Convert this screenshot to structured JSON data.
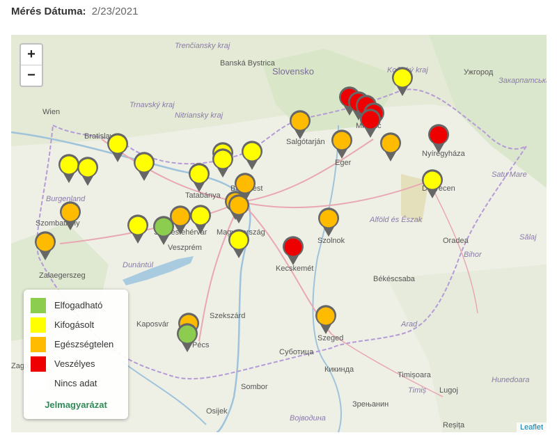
{
  "header": {
    "label": "Mérés Dátuma:",
    "date": "2/23/2021"
  },
  "zoom": {
    "in": "+",
    "out": "−"
  },
  "legend": {
    "items": [
      {
        "label": "Elfogadható",
        "color": "#8ccd50"
      },
      {
        "label": "Kifogásolt",
        "color": "#ffff00"
      },
      {
        "label": "Egészségtelen",
        "color": "#ffbb00"
      },
      {
        "label": "Veszélyes",
        "color": "#ee0000"
      },
      {
        "label": "Nincs adat",
        "color": "#ffffff"
      }
    ],
    "title": "Jelmagyarázat"
  },
  "attribution": "Leaflet",
  "map_labels": [
    "Trenčiansky kraj",
    "Banská Bystrica",
    "Slovensko",
    "Košický kraj",
    "Ужгород",
    "Закарпатська область",
    "Trnavský kraj",
    "Nitriansky kraj",
    "Wien",
    "Bratislava",
    "Miskolc",
    "Nyíregyháza",
    "Salgótarján",
    "Eger",
    "Tatabánya",
    "Budapest",
    "Debrecen",
    "Satu Mare",
    "Burgenland",
    "Szombathely",
    "Alföld és Észak",
    "Szolnok",
    "Magyarország",
    "Székesfehérvár",
    "Veszprém",
    "Oradea",
    "Bihor",
    "Sălaj",
    "Dunántúl",
    "Zalaegerszeg",
    "Kecskemét",
    "Békéscsaba",
    "Szekszárd",
    "Kaposvár",
    "Arad",
    "Szeged",
    "Pécs",
    "Суботица",
    "Timișoara",
    "Timiș",
    "Hunedoara",
    "Кикинда",
    "Lugoj",
    "Sombor",
    "Зрењанин",
    "Osijek",
    "Војводина",
    "Reșița",
    "Zagreb"
  ],
  "stations": [
    {
      "status": "Kifogásolt"
    },
    {
      "status": "Veszélyes"
    },
    {
      "status": "Veszélyes"
    },
    {
      "status": "Veszélyes"
    },
    {
      "status": "Veszélyes"
    },
    {
      "status": "Veszélyes"
    },
    {
      "status": "Egészségtelen"
    },
    {
      "status": "Egészségtelen"
    },
    {
      "status": "Egészségtelen"
    },
    {
      "status": "Veszélyes"
    },
    {
      "status": "Kifogásolt"
    },
    {
      "status": "Kifogásolt"
    },
    {
      "status": "Kifogásolt"
    },
    {
      "status": "Kifogásolt"
    },
    {
      "status": "Kifogásolt"
    },
    {
      "status": "Kifogásolt"
    },
    {
      "status": "Kifogásolt"
    },
    {
      "status": "Kifogásolt"
    },
    {
      "status": "Kifogásolt"
    },
    {
      "status": "Egészségtelen"
    },
    {
      "status": "Egészségtelen"
    },
    {
      "status": "Egészségtelen"
    },
    {
      "status": "Egészségtelen"
    },
    {
      "status": "Egészségtelen"
    },
    {
      "status": "Egészségtelen"
    },
    {
      "status": "Kifogásolt"
    },
    {
      "status": "Elfogadható"
    },
    {
      "status": "Kifogásolt"
    },
    {
      "status": "Egészségtelen"
    },
    {
      "status": "Kifogásolt"
    },
    {
      "status": "Veszélyes"
    },
    {
      "status": "Egészségtelen"
    },
    {
      "status": "Egészségtelen"
    },
    {
      "status": "Elfogadható"
    },
    {
      "status": "Elfogadható"
    }
  ]
}
